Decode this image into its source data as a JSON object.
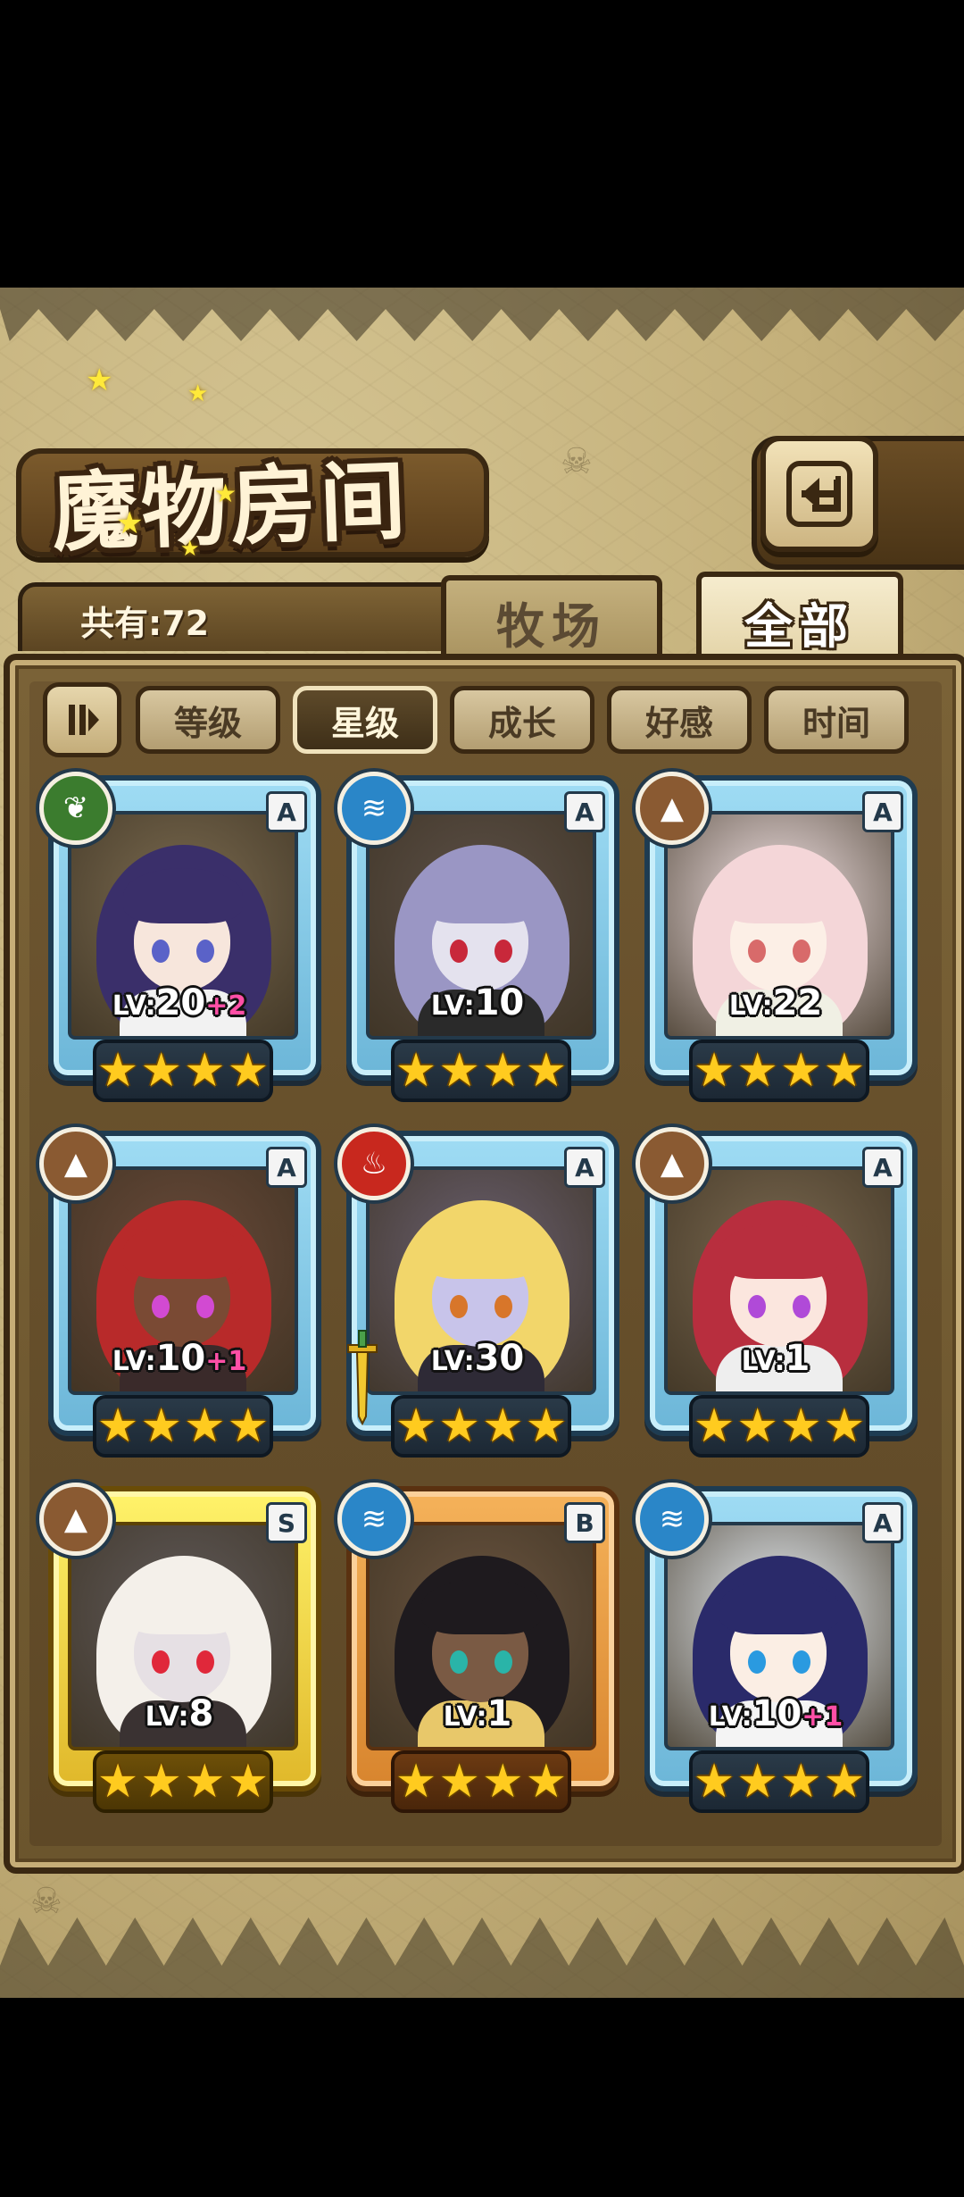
{
  "title": "魔物房间",
  "count": {
    "text": "共有:72"
  },
  "tabs": [
    {
      "label": "牧场",
      "active": false
    },
    {
      "label": "全部",
      "active": true
    }
  ],
  "sort_buttons": [
    {
      "label": "等级",
      "active": false
    },
    {
      "label": "星级",
      "active": true
    },
    {
      "label": "成长",
      "active": false
    },
    {
      "label": "好感",
      "active": false
    },
    {
      "label": "时间",
      "active": false
    }
  ],
  "cards": [
    {
      "element": "nature",
      "rarity": "A",
      "level": "20",
      "bonus": "+2",
      "stars": 4
    },
    {
      "element": "water",
      "rarity": "A",
      "level": "10",
      "bonus": "",
      "stars": 4
    },
    {
      "element": "earth",
      "rarity": "A",
      "level": "22",
      "bonus": "",
      "stars": 4
    },
    {
      "element": "earth",
      "rarity": "A",
      "level": "10",
      "bonus": "+1",
      "stars": 4
    },
    {
      "element": "fire",
      "rarity": "A",
      "level": "30",
      "bonus": "",
      "stars": 4,
      "weapon": true
    },
    {
      "element": "earth",
      "rarity": "A",
      "level": "1",
      "bonus": "",
      "stars": 4
    },
    {
      "element": "earth",
      "rarity": "S",
      "level": "8",
      "bonus": "",
      "stars": 4
    },
    {
      "element": "water",
      "rarity": "B",
      "level": "1",
      "bonus": "",
      "stars": 4
    },
    {
      "element": "water",
      "rarity": "A",
      "level": "10",
      "bonus": "+1",
      "stars": 4
    }
  ],
  "colors": {
    "frame_a": "#7fc8e8",
    "frame_s": "#f0d43e",
    "frame_b": "#e89a44",
    "bonus": "#ff4fa6",
    "star": "#ffcb1f"
  }
}
